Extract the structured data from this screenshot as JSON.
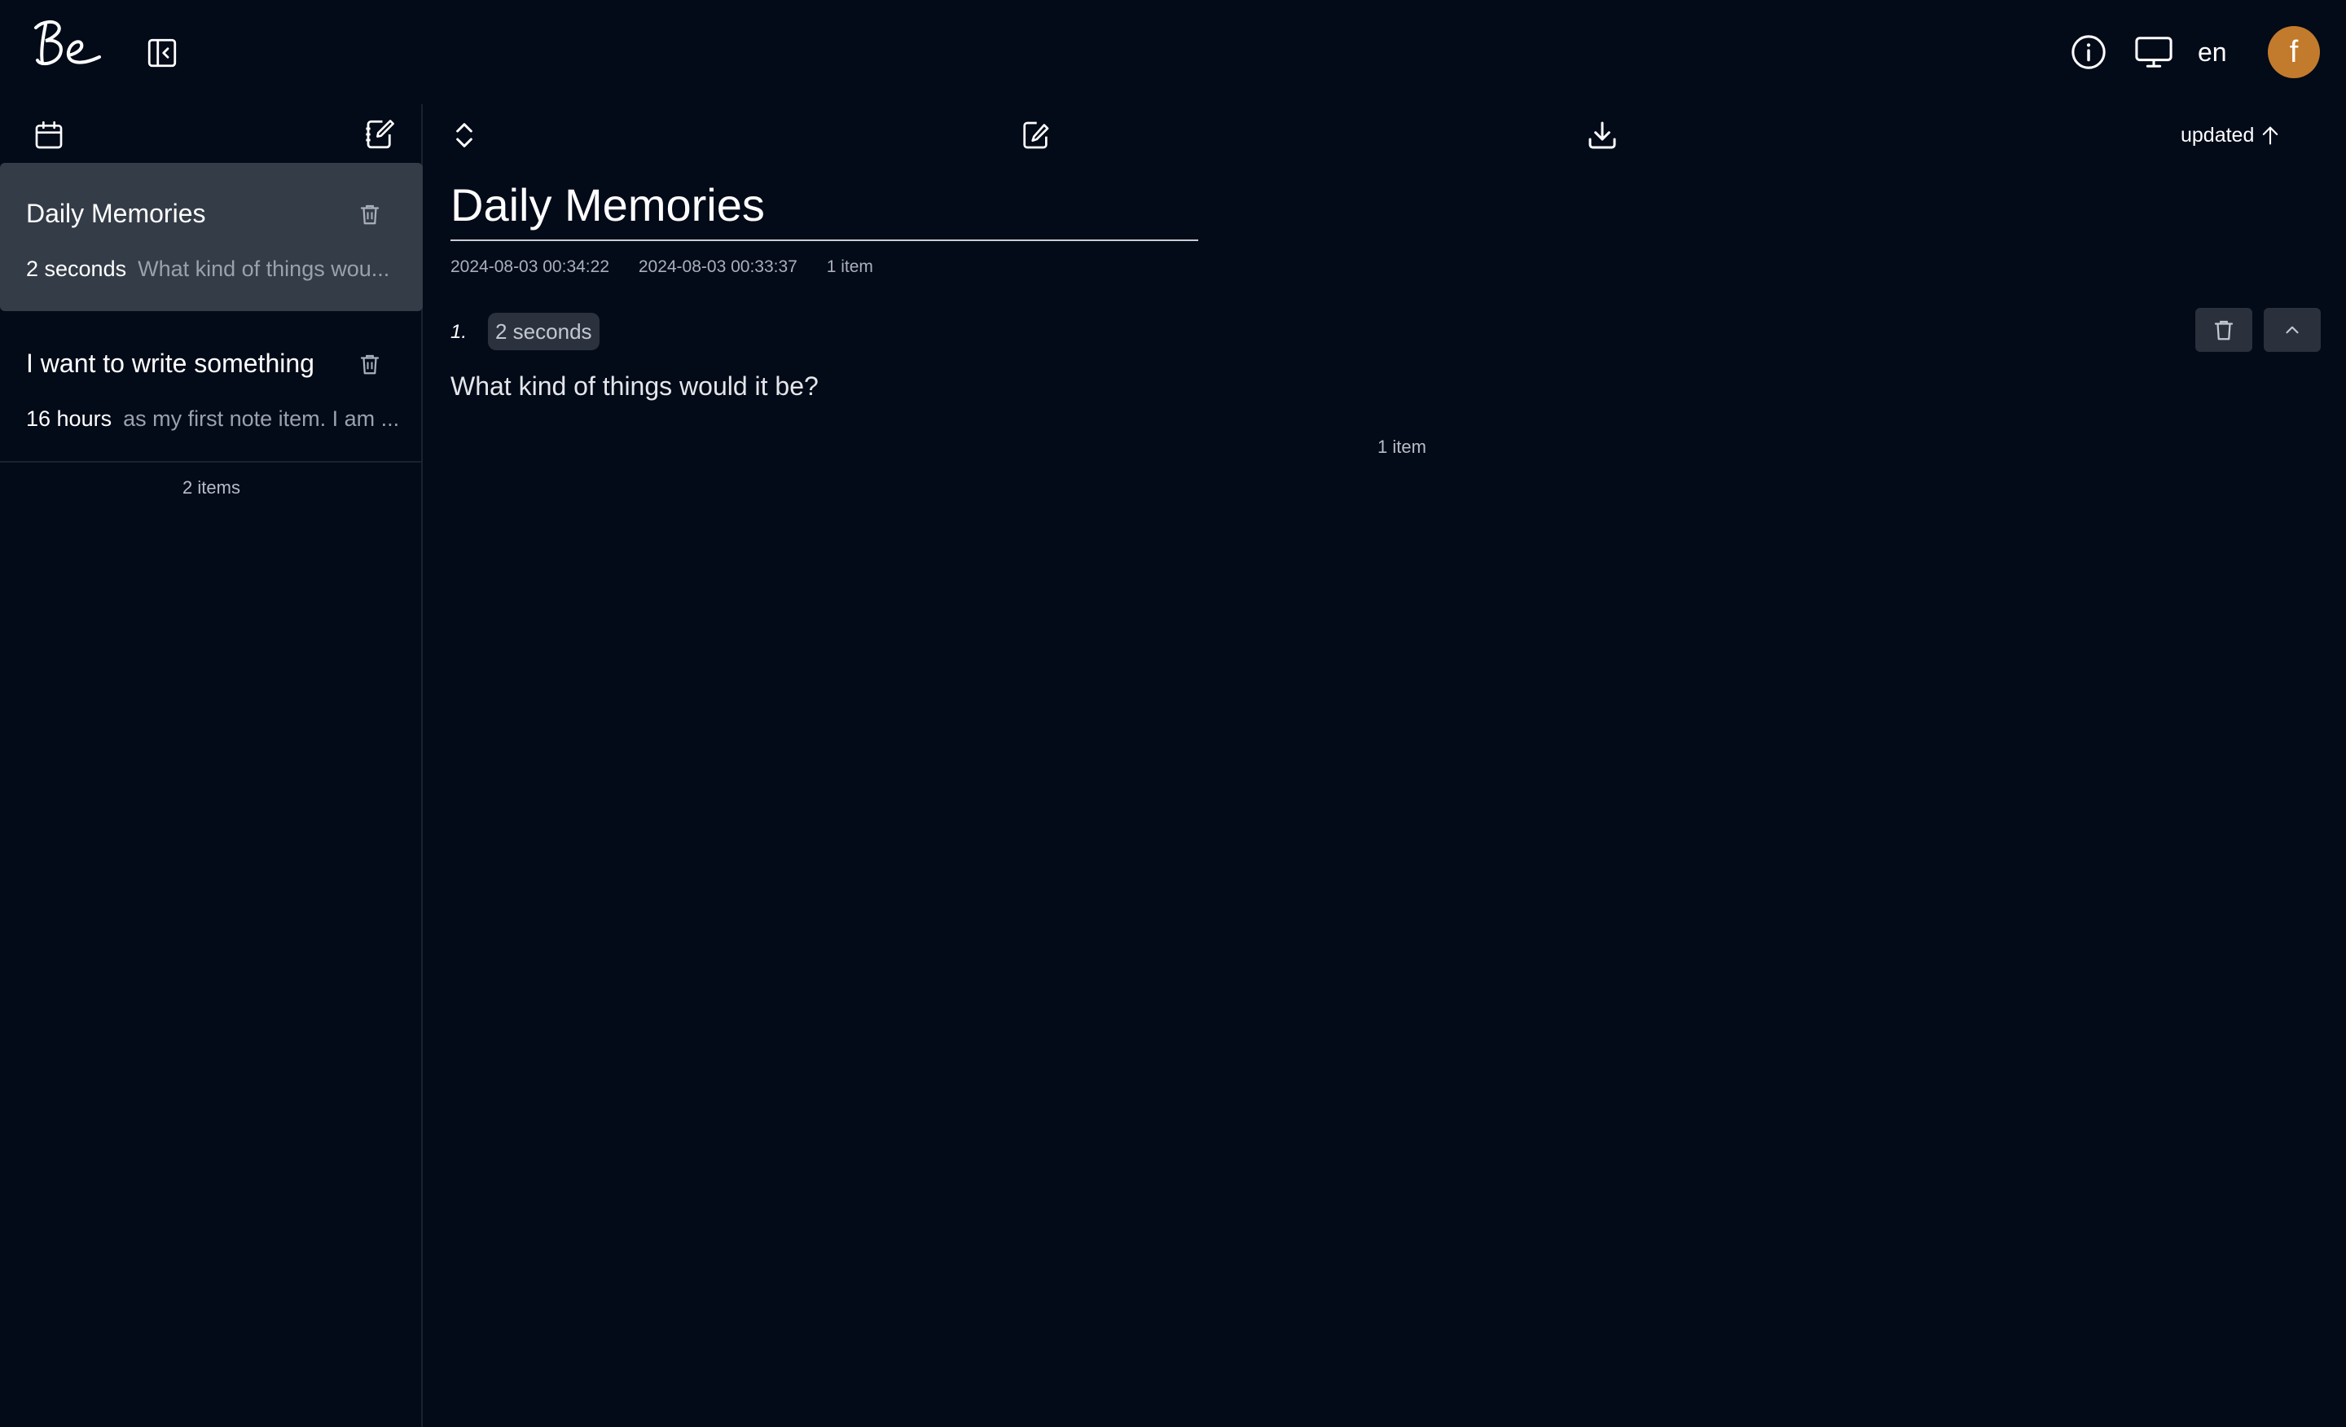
{
  "header": {
    "logo_text": "Be",
    "language": "en",
    "avatar_letter": "f",
    "avatar_color": "#c27a2c"
  },
  "sidebar": {
    "notes": [
      {
        "title": "Daily Memories",
        "age": "2 seconds",
        "preview": "What kind of things wou...",
        "selected": true
      },
      {
        "title": "I want to write something",
        "age": "16 hours",
        "preview": "as my first note item. I am ...",
        "selected": false
      }
    ],
    "count_label": "2 items"
  },
  "main": {
    "sort_label": "updated",
    "title": "Daily Memories",
    "updated_at": "2024-08-03 00:34:22",
    "created_at": "2024-08-03 00:33:37",
    "item_count": "1 item",
    "entries": [
      {
        "number": "1.",
        "age": "2 seconds",
        "text": "What kind of things would it be?"
      }
    ],
    "footer_count": "1 item"
  },
  "colors": {
    "background": "#030a18",
    "selected_item": "#343c48",
    "badge": "#2b323e",
    "muted_text": "#9aa1ad"
  },
  "icons": [
    "sidebar-collapse-icon",
    "info-icon",
    "monitor-icon",
    "calendar-icon",
    "new-note-icon",
    "trash-icon",
    "expand-collapse-icon",
    "edit-icon",
    "download-icon",
    "arrow-up-icon",
    "chevron-up-icon"
  ]
}
